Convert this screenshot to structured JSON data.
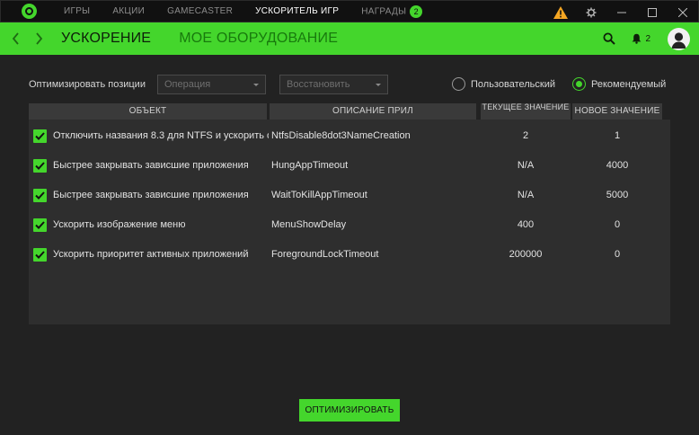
{
  "topnav": {
    "items": [
      {
        "label": "ИГРЫ"
      },
      {
        "label": "АКЦИИ"
      },
      {
        "label": "GAMECASTER"
      },
      {
        "label": "УСКОРИТЕЛЬ ИГР"
      },
      {
        "label": "НАГРАДЫ"
      }
    ],
    "rewards_badge": "2",
    "active_index": 3
  },
  "subnav": {
    "tabs": [
      {
        "label": "УСКОРЕНИЕ"
      },
      {
        "label": "МОЕ ОБОРУДОВАНИЕ"
      }
    ],
    "notification_count": "2"
  },
  "options": {
    "label": "Оптимизировать позиции",
    "operation_select": {
      "placeholder": "Операция"
    },
    "restore_select": {
      "placeholder": "Восстановить"
    },
    "radio_custom": {
      "label": "Пользовательский",
      "checked": false
    },
    "radio_recommended": {
      "label": "Рекомендуемый",
      "checked": true
    }
  },
  "table": {
    "headers": [
      "ОБЪЕКТ",
      "ОПИСАНИЕ ПРИЛ",
      "ТЕКУЩЕЕ ЗНАЧЕНИЕ",
      "НОВОЕ ЗНАЧЕНИЕ"
    ],
    "rows": [
      {
        "checked": true,
        "object": "Отключить названия 8.3 для NTFS и ускорить о...",
        "description": "NtfsDisable8dot3NameCreation",
        "current": "2",
        "new": "1"
      },
      {
        "checked": true,
        "object": "Быстрее закрывать зависшие приложения",
        "description": "HungAppTimeout",
        "current": "N/A",
        "new": "4000"
      },
      {
        "checked": true,
        "object": "Быстрее закрывать зависшие приложения",
        "description": "WaitToKillAppTimeout",
        "current": "N/A",
        "new": "5000"
      },
      {
        "checked": true,
        "object": "Ускорить изображение меню",
        "description": "MenuShowDelay",
        "current": "400",
        "new": "0"
      },
      {
        "checked": true,
        "object": "Ускорить приоритет активных приложений",
        "description": "ForegroundLockTimeout",
        "current": "200000",
        "new": "0"
      }
    ]
  },
  "optimize_button": {
    "label": "ОПТИМИЗИРОВАТЬ"
  },
  "colors": {
    "accent": "#44d62c",
    "background": "#222222",
    "topbar": "#111111",
    "warning": "#f5a623"
  }
}
